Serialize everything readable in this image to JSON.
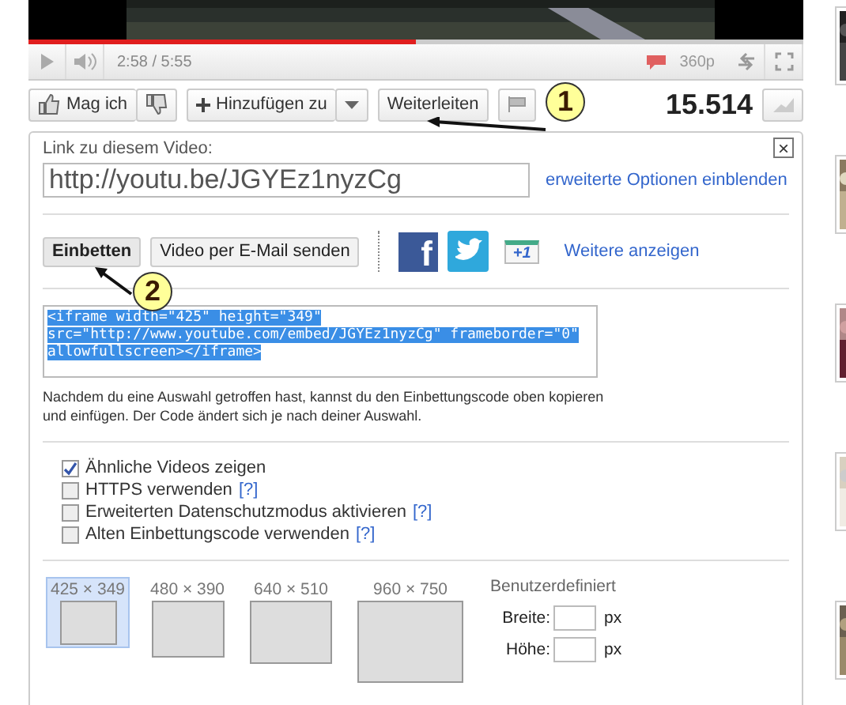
{
  "player": {
    "time": "2:58 / 5:55",
    "progress": {
      "level": 0.5
    },
    "quality": "360p"
  },
  "actions": {
    "like": "Mag ich",
    "add": "Hinzufügen zu",
    "share": "Weiterleiten",
    "views": "15.514"
  },
  "annotations": [
    {
      "label": "1"
    },
    {
      "label": "2"
    }
  ],
  "share_panel": {
    "close": "×",
    "link_label": "Link zu diesem Video:",
    "link": "http://youtu.be/JGYEz1nyzCg",
    "more_options": "erweiterte Optionen einblenden",
    "tabs": [
      {
        "label": "Einbetten",
        "selected": true
      },
      {
        "label": "Video per E-Mail senden",
        "selected": false
      }
    ],
    "share_icons": [
      {
        "kind": "facebook",
        "glyph": "f"
      },
      {
        "kind": "twitter"
      },
      {
        "kind": "plusone",
        "glyph": "+1"
      }
    ],
    "more_link": "Weitere anzeigen",
    "embed_code": "<iframe width=\"425\" height=\"349\" src=\"http://www.youtube.com/embed/JGYEz1nyzCg\" frameborder=\"0\" allowfullscreen></iframe>",
    "hint": "Nachdem du eine Auswahl getroffen hast, kannst du den Einbettungscode oben kopieren und einfügen. Der Code ändert sich je nach deiner Auswahl.",
    "options": [
      {
        "label": "Ähnliche Videos zeigen",
        "checked": true
      },
      {
        "label": "HTTPS verwenden",
        "help": "[?]",
        "checked": false
      },
      {
        "label": "Erweiterten Datenschutzmodus aktivieren",
        "help": "[?]",
        "checked": false
      },
      {
        "label": "Alten Einbettungscode verwenden",
        "help": "[?]",
        "checked": false
      }
    ],
    "sizes": [
      {
        "label": "425 × 349",
        "selected": true
      },
      {
        "label": "480 × 390",
        "selected": false
      },
      {
        "label": "640 × 510",
        "selected": false
      },
      {
        "label": "960 × 750",
        "selected": false
      }
    ],
    "custom": {
      "title": "Benutzerdefiniert",
      "fields": [
        {
          "label": "Breite:",
          "unit": "px"
        },
        {
          "label": "Höhe:",
          "unit": "px"
        }
      ]
    }
  }
}
